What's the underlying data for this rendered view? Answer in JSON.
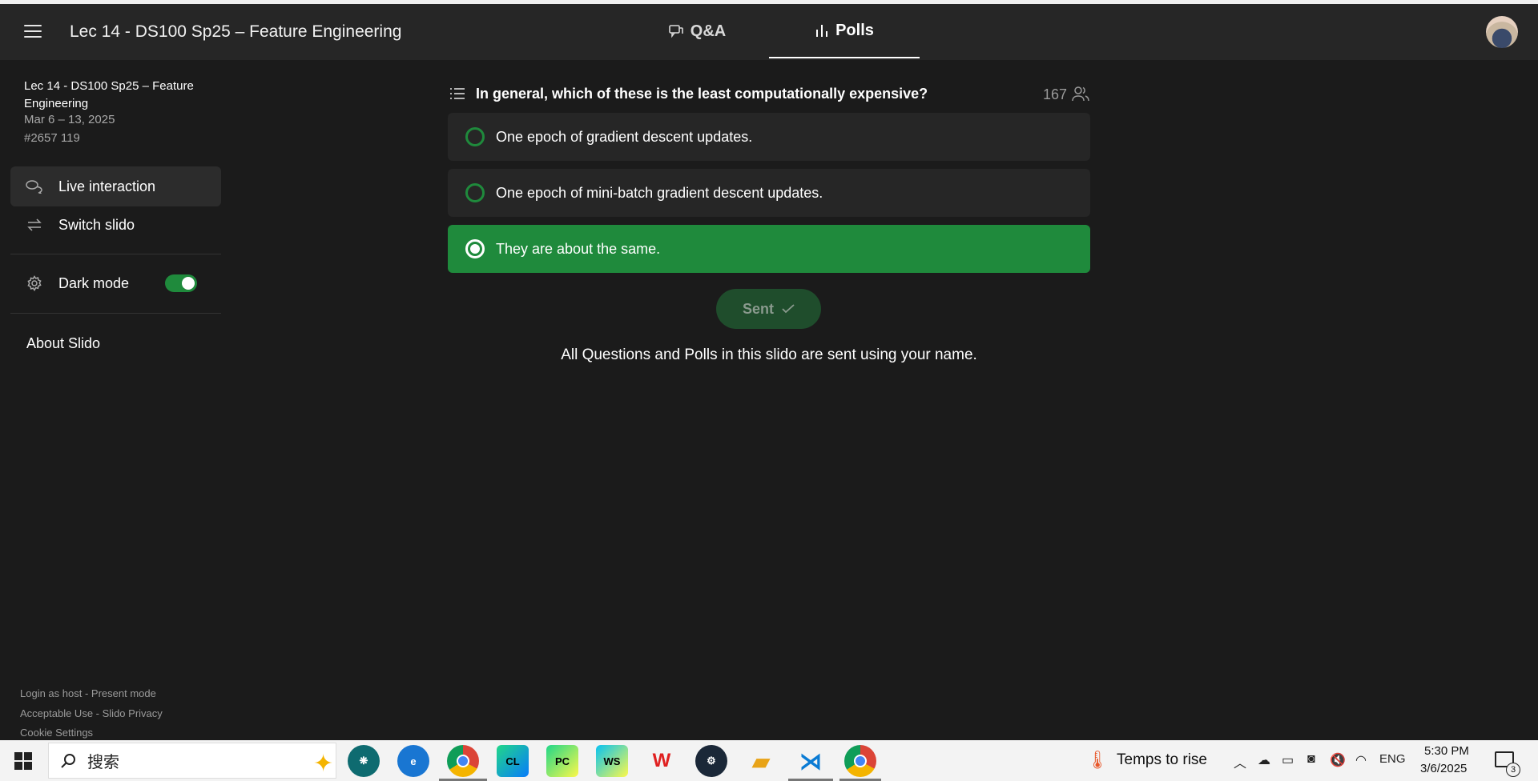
{
  "header": {
    "title": "Lec 14 - DS100 Sp25 – Feature Engineering",
    "tabs": [
      {
        "label": "Q&A",
        "icon": "chat-bubbles-icon",
        "active": false
      },
      {
        "label": "Polls",
        "icon": "bar-chart-icon",
        "active": true
      }
    ]
  },
  "sidebar": {
    "event_title": "Lec 14 - DS100 Sp25 – Feature Engineering",
    "event_dates": "Mar 6 – 13, 2025",
    "event_code": "#2657 119",
    "items": [
      {
        "label": "Live interaction",
        "icon": "chat-icon",
        "active": true
      },
      {
        "label": "Switch slido",
        "icon": "swap-icon",
        "active": false
      }
    ],
    "dark_mode": {
      "label": "Dark mode",
      "on": true
    },
    "about": "About Slido",
    "footer": {
      "login_host": "Login as host",
      "present_mode": "Present mode",
      "acceptable_use": "Acceptable Use",
      "slido_privacy": "Slido Privacy",
      "cookie_settings": "Cookie Settings",
      "separator": " - "
    }
  },
  "poll": {
    "question": "In general, which of these is the least computationally expensive?",
    "participants": "167",
    "options": [
      {
        "label": "One epoch of gradient descent updates.",
        "selected": false
      },
      {
        "label": "One epoch of mini-batch gradient descent updates.",
        "selected": false
      },
      {
        "label": "They are about the same.",
        "selected": true
      }
    ],
    "sent_label": "Sent",
    "notice": "All Questions and Polls in this slido are sent using your name."
  },
  "colors": {
    "background": "#1b1b1b",
    "header": "#262626",
    "accent_green": "#1f8a3c",
    "option_bg": "#262626"
  },
  "taskbar": {
    "search_text": "搜索",
    "apps": [
      {
        "name": "brain-app-icon",
        "label": ""
      },
      {
        "name": "edge-icon",
        "label": ""
      },
      {
        "name": "chrome-icon",
        "label": ""
      },
      {
        "name": "clion-icon",
        "label": "CL"
      },
      {
        "name": "pycharm-icon",
        "label": "PC"
      },
      {
        "name": "webstorm-icon",
        "label": "WS"
      },
      {
        "name": "wps-icon",
        "label": "W"
      },
      {
        "name": "steam-icon",
        "label": ""
      },
      {
        "name": "file-explorer-icon",
        "label": ""
      },
      {
        "name": "vscode-icon",
        "label": ""
      },
      {
        "name": "chrome-profile-icon",
        "label": ""
      }
    ],
    "weather": "Temps to rise",
    "language": "ENG",
    "time": "5:30 PM",
    "date": "3/6/2025",
    "notification_count": "3"
  }
}
